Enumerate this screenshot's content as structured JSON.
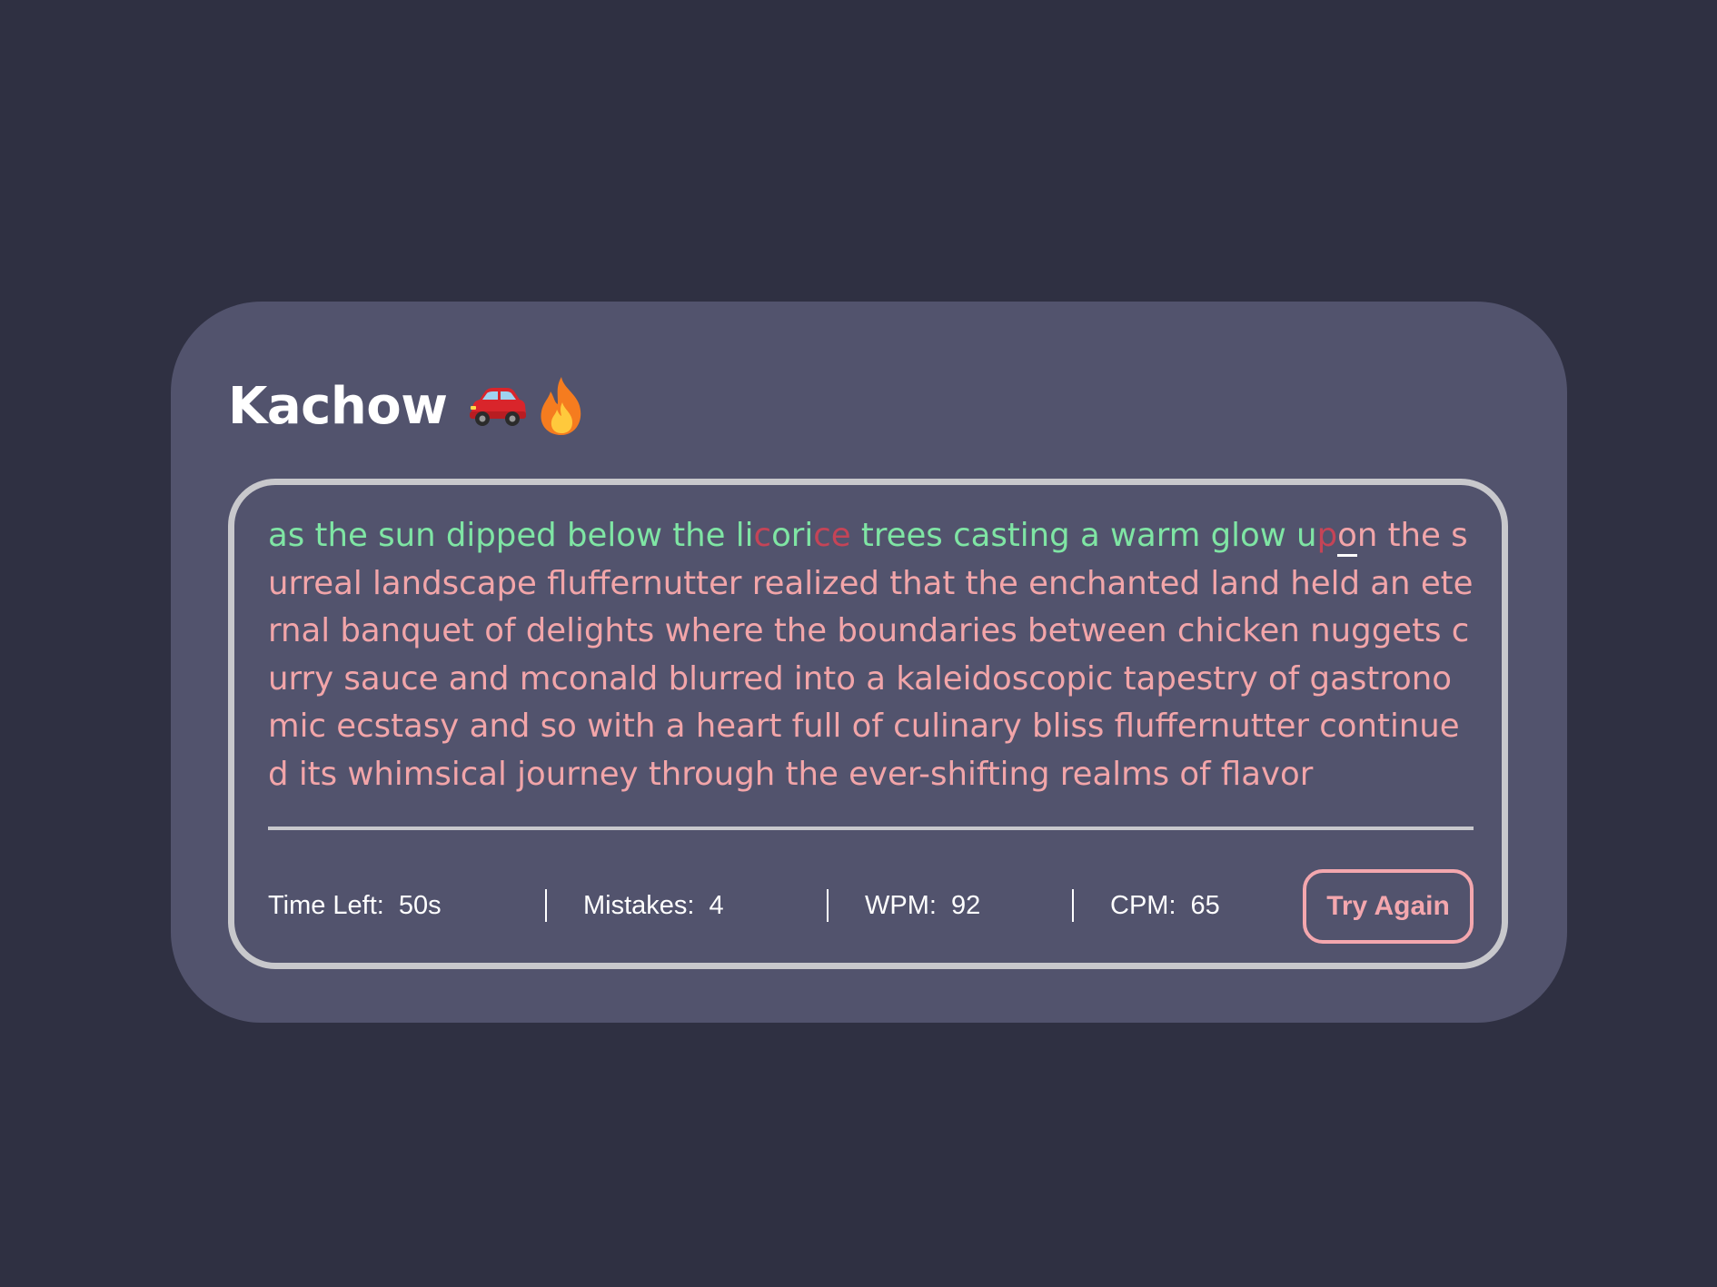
{
  "app": {
    "title": "Kachow",
    "emojis": [
      "car-icon",
      "fire-icon"
    ]
  },
  "typing": {
    "segments": [
      {
        "text": "as the sun dipped below the li",
        "state": "correct"
      },
      {
        "text": "c",
        "state": "incorrect"
      },
      {
        "text": "ori",
        "state": "correct"
      },
      {
        "text": "ce",
        "state": "incorrect"
      },
      {
        "text": " trees casting a warm glow u",
        "state": "correct"
      },
      {
        "text": "p",
        "state": "incorrect"
      },
      {
        "text": "o",
        "state": "active"
      },
      {
        "text": "n the surreal landscape fluffernutter realized that the enchanted land held an eternal banquet of delights where the boundaries between chicken nuggets curry sauce and mconald blurred into a kaleidoscopic tapestry of gastronomic ecstasy and so with a heart full of culinary bliss fluffernutter continued its whimsical journey through the ever-shifting realms of flavor",
        "state": "pending"
      }
    ]
  },
  "stats": {
    "time_left_label": "Time Left:",
    "time_left_value": "50s",
    "mistakes_label": "Mistakes:",
    "mistakes_value": "4",
    "wpm_label": "WPM:",
    "wpm_value": "92",
    "cpm_label": "CPM:",
    "cpm_value": "65"
  },
  "actions": {
    "try_again_label": "Try Again"
  },
  "colors": {
    "background": "#2f3042",
    "card": "#52536d",
    "correct": "#7fe5a4",
    "incorrect": "#c54457",
    "pending": "#f2a5a9",
    "accent": "#f4a7ae"
  }
}
